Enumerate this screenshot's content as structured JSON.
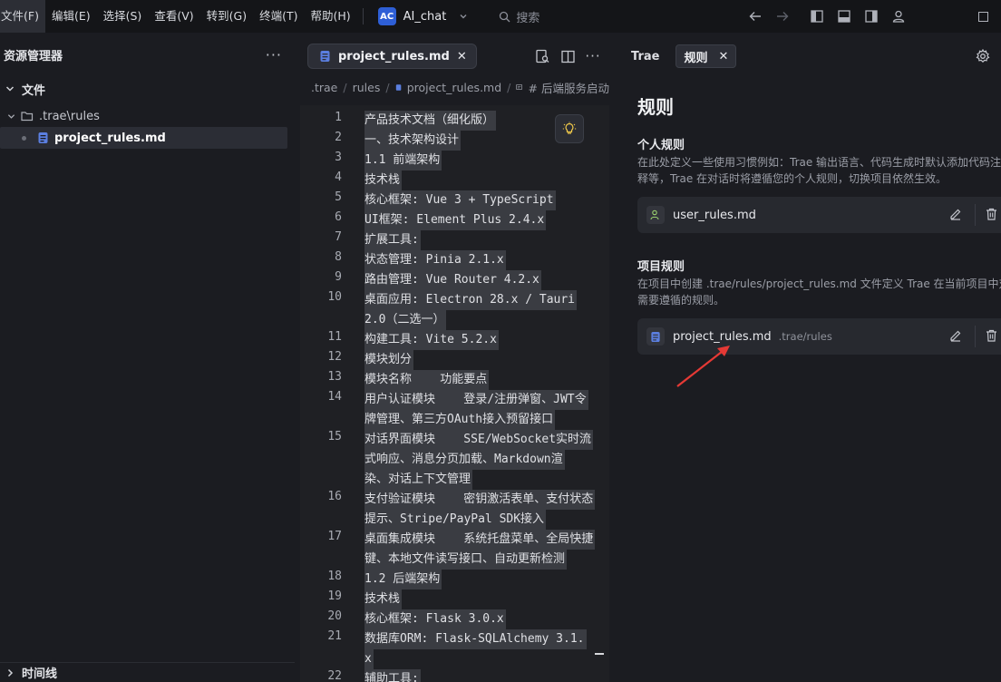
{
  "menu": [
    "文件(F)",
    "编辑(E)",
    "选择(S)",
    "查看(V)",
    "转到(G)",
    "终端(T)",
    "帮助(H)"
  ],
  "project": {
    "badge": "AC",
    "name": "AI_chat"
  },
  "search": {
    "placeholder": "搜索"
  },
  "sidebar": {
    "title": "资源管理器",
    "section": "文件",
    "folder": ".trae\\rules",
    "file": "project_rules.md",
    "timeline": "时间线"
  },
  "editor": {
    "tab_label": "project_rules.md",
    "breadcrumb": [
      ".trae",
      "rules",
      "project_rules.md",
      "# 后端服务启动"
    ],
    "lines": [
      {
        "n": "1",
        "t": "产品技术文档（细化版）"
      },
      {
        "n": "2",
        "t": "一、技术架构设计"
      },
      {
        "n": "3",
        "t": "1.1 前端架构"
      },
      {
        "n": "4",
        "t": "技术栈"
      },
      {
        "n": "5",
        "t": "核心框架: Vue 3 + TypeScript"
      },
      {
        "n": "6",
        "t": "UI框架: Element Plus 2.4.x"
      },
      {
        "n": "7",
        "t": "扩展工具:"
      },
      {
        "n": "8",
        "t": "状态管理: Pinia 2.1.x"
      },
      {
        "n": "9",
        "t": "路由管理: Vue Router 4.2.x"
      },
      {
        "n": "10",
        "t": "桌面应用: Electron 28.x / Tauri"
      },
      {
        "n": "",
        "t": "2.0（二选一）"
      },
      {
        "n": "11",
        "t": "构建工具: Vite 5.2.x"
      },
      {
        "n": "12",
        "t": "模块划分"
      },
      {
        "n": "13",
        "t": "模块名称    功能要点"
      },
      {
        "n": "14",
        "t": "用户认证模块    登录/注册弹窗、JWT令"
      },
      {
        "n": "",
        "t": "牌管理、第三方OAuth接入预留接口"
      },
      {
        "n": "15",
        "t": "对话界面模块    SSE/WebSocket实时流"
      },
      {
        "n": "",
        "t": "式响应、消息分页加载、Markdown渲"
      },
      {
        "n": "",
        "t": "染、对话上下文管理"
      },
      {
        "n": "16",
        "t": "支付验证模块    密钥激活表单、支付状态"
      },
      {
        "n": "",
        "t": "提示、Stripe/PayPal SDK接入"
      },
      {
        "n": "17",
        "t": "桌面集成模块    系统托盘菜单、全局快捷"
      },
      {
        "n": "",
        "t": "键、本地文件读写接口、自动更新检测"
      },
      {
        "n": "18",
        "t": "1.2 后端架构"
      },
      {
        "n": "19",
        "t": "技术栈"
      },
      {
        "n": "20",
        "t": "核心框架: Flask 3.0.x"
      },
      {
        "n": "21",
        "t": "数据库ORM: Flask-SQLAlchemy 3.1."
      },
      {
        "n": "",
        "t": "x"
      },
      {
        "n": "22",
        "t": "辅助工具:"
      }
    ]
  },
  "rules_panel": {
    "tab_trae": "Trae",
    "tab_rules": "规则",
    "title": "规则",
    "personal": {
      "title": "个人规则",
      "desc1": "在此处定义一些使用习惯例如：Trae 输出语言、代码生成时默认添加代码注",
      "desc2": "释等，Trae 在对话时将遵循您的个人规则，切换项目依然生效。",
      "file": "user_rules.md"
    },
    "project": {
      "title": "项目规则",
      "desc1": "在项目中创建 .trae/rules/project_rules.md 文件定义 Trae 在当前项目中对话时",
      "desc2": "需要遵循的规则。",
      "file": "project_rules.md",
      "path": ".trae/rules"
    }
  },
  "colors": {
    "accent": "#2e5fd6",
    "annotation_arrow": "#e53935"
  }
}
